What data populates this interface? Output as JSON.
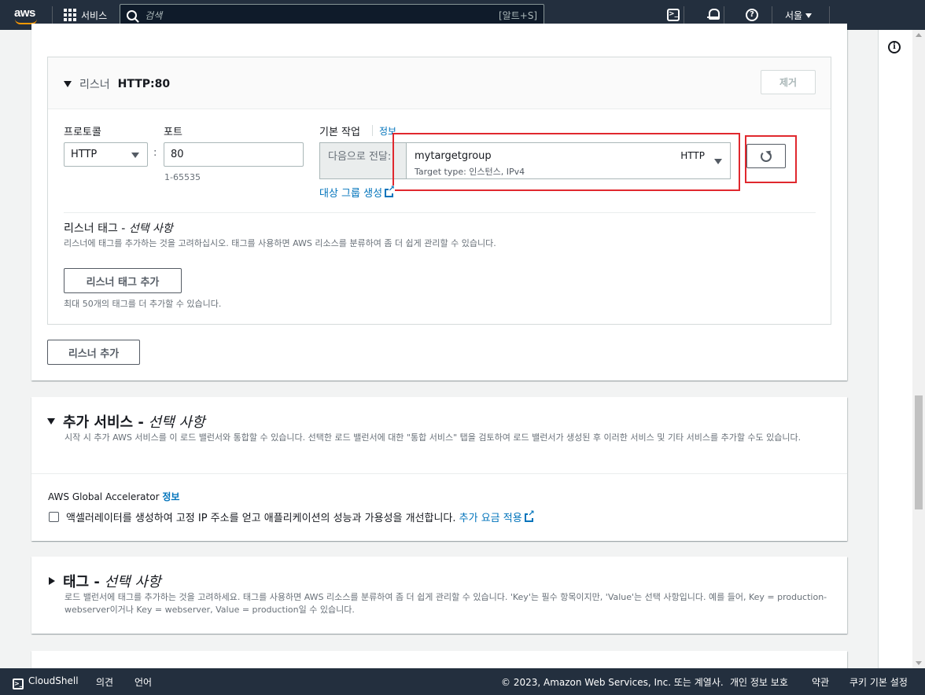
{
  "nav": {
    "logo": "aws",
    "services_label": "서비스",
    "search_placeholder": "검색",
    "search_shortcut": "[알트+S]",
    "region": "서울"
  },
  "listener": {
    "title_prefix": "리스너",
    "title_value": "HTTP:80",
    "remove_button": "제거",
    "protocol_label": "프로토콜",
    "protocol_value": "HTTP",
    "colon": ":",
    "port_label": "포트",
    "port_value": "80",
    "port_hint": "1-65535",
    "default_action_label": "기본 작업",
    "info_link": "정보",
    "forward_prefix": "다음으로 전달:",
    "target_group": {
      "name": "mytargetgroup",
      "protocol": "HTTP",
      "subtitle": "Target type: 인스턴스, IPv4"
    },
    "create_target_group_link": "대상 그룹 생성",
    "tags_title": "리스너 태그 -",
    "tags_title_optional": "선택 사항",
    "tags_desc": "리스너에 태그를 추가하는 것을 고려하십시오. 태그를 사용하면 AWS 리소스를 분류하여 좀 더 쉽게 관리할 수 있습니다.",
    "add_tag_button": "리스너 태그 추가",
    "tag_limit_hint": "최대 50개의 태그를 더 추가할 수 있습니다."
  },
  "add_listener_button": "리스너 추가",
  "addon_services": {
    "title": "추가 서비스 -",
    "title_optional": "선택 사항",
    "desc": "시작 시 추가 AWS 서비스를 이 로드 밸런서와 통합할 수 있습니다. 선택한 로드 밸런서에 대한 \"통합 서비스\" 탭을 검토하여 로드 밸런서가 생성된 후 이러한 서비스 및 기타 서비스를 추가할 수도 있습니다.",
    "accelerator_label": "AWS Global Accelerator",
    "accelerator_info": "정보",
    "accelerator_checkbox_label": "액셀러레이터를 생성하여 고정 IP 주소를 얻고 애플리케이션의 성능과 가용성을 개선합니다.",
    "extra_charge_link": "추가 요금 적용"
  },
  "tags": {
    "title": "태그 -",
    "title_optional": "선택 사항",
    "desc": "로드 밸런서에 태그를 추가하는 것을 고려하세요. 태그를 사용하면 AWS 리소스를 분류하여 좀 더 쉽게 관리할 수 있습니다. 'Key'는 필수 항목이지만, 'Value'는 선택 사항입니다. 예를 들어, Key = production-webserver이거나 Key = webserver, Value = production일 수 있습니다."
  },
  "footer": {
    "cloudshell": "CloudShell",
    "feedback": "의견",
    "language": "언어",
    "copyright": "© 2023, Amazon Web Services, Inc. 또는 계열사.",
    "privacy": "개인 정보 보호",
    "terms": "약관",
    "cookie": "쿠키 기본 설정"
  },
  "colors": {
    "nav_bg": "#232f3e",
    "link": "#0073bb",
    "highlight": "#e0282e"
  }
}
